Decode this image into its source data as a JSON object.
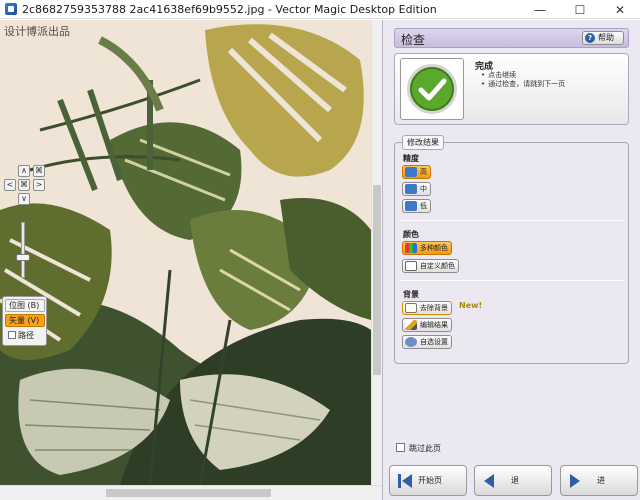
{
  "window": {
    "title": "2c8682759353788 2ac41638ef69b9552.jpg - Vector Magic Desktop Edition",
    "minimize": "—",
    "maximize": "☐",
    "close": "✕"
  },
  "canvas": {
    "watermark": "设计博派出品"
  },
  "nav": {
    "up": "∧",
    "fit": "⌘",
    "left": "<",
    "actual": "⌘",
    "right": ">",
    "down": "∨"
  },
  "view": {
    "bitmap": "位图 (B)",
    "vector": "矢量 (V)",
    "path": "路径"
  },
  "panel": {
    "title": "检查",
    "help": "帮助",
    "status_title": "完成",
    "status_lines": [
      "点击继续",
      "通过检查，请跳到下一页"
    ],
    "group_title": "修改结果",
    "detail": {
      "label": "精度",
      "options": [
        "高",
        "中",
        "低"
      ],
      "selected": "高"
    },
    "color": {
      "label": "颜色",
      "options": [
        "多种颜色",
        "自定义颜色"
      ],
      "selected": "多种颜色"
    },
    "background": {
      "label": "背景",
      "options": [
        "去除背景",
        "编辑结果",
        "自选设置"
      ],
      "new_tag": "New!"
    },
    "skip_label": "跳过此页",
    "footer": {
      "start": "开始页",
      "back": "退",
      "next": "进"
    }
  },
  "colors": {
    "accent": "#f7a218",
    "panel_bg": "#ece8f2",
    "check_green": "#5aa82c"
  }
}
